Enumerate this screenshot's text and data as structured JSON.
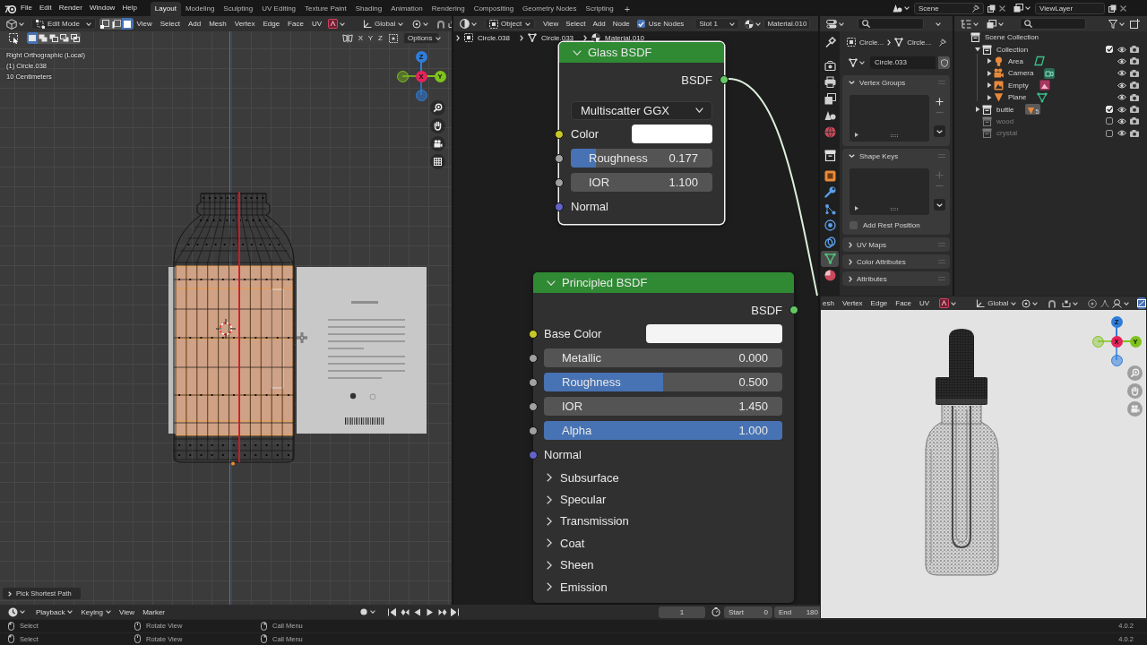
{
  "top_bar": {
    "menus": [
      "File",
      "Edit",
      "Render",
      "Window",
      "Help"
    ],
    "workspaces": [
      {
        "label": "Layout",
        "selected": true
      },
      {
        "label": "Modeling",
        "selected": false
      },
      {
        "label": "Sculpting",
        "selected": false
      },
      {
        "label": "UV Editing",
        "selected": false
      },
      {
        "label": "Texture Paint",
        "selected": false
      },
      {
        "label": "Shading",
        "selected": false
      },
      {
        "label": "Animation",
        "selected": false
      },
      {
        "label": "Rendering",
        "selected": false
      },
      {
        "label": "Compositing",
        "selected": false
      },
      {
        "label": "Geometry Nodes",
        "selected": false
      },
      {
        "label": "Scripting",
        "selected": false
      }
    ],
    "add_workspace": "+",
    "scene": "Scene",
    "view_layer": "ViewLayer"
  },
  "viewport": {
    "mode": "Edit Mode",
    "select_modes": [
      {
        "kind": "vertex",
        "selected": false
      },
      {
        "kind": "edge",
        "selected": false
      },
      {
        "kind": "face",
        "selected": true
      }
    ],
    "menus": [
      "View",
      "Select",
      "Add",
      "Mesh",
      "Vertex",
      "Edge",
      "Face",
      "UV"
    ],
    "orientation": "Global",
    "selection_ops": [
      {
        "kind": "set",
        "selected": true
      },
      {
        "kind": "extend",
        "selected": false
      },
      {
        "kind": "subtract",
        "selected": false
      },
      {
        "kind": "invert",
        "selected": false
      },
      {
        "kind": "intersect",
        "selected": false
      }
    ],
    "mirror_axes": [
      {
        "label": "X",
        "selected": false
      },
      {
        "label": "Y",
        "selected": false
      },
      {
        "label": "Z",
        "selected": false
      }
    ],
    "options": "Options",
    "info": [
      "Right Orthographic (Local)",
      "(1) Circle.038",
      "10 Centimeters"
    ],
    "gizmo": [
      {
        "label": "Z",
        "color": "#2f7ddb"
      },
      {
        "label": "X",
        "color": "#e3245a"
      },
      {
        "label": "Y",
        "color": "#7fc31b"
      }
    ],
    "last_operator": "Pick Shortest Path"
  },
  "node_editor": {
    "mode": "Object",
    "menus": [
      "View",
      "Select",
      "Add",
      "Node"
    ],
    "use_nodes": {
      "label": "Use Nodes",
      "checked": true
    },
    "slot": "Slot 1",
    "material": "Material.010",
    "breadcrumbs": [
      {
        "kind": "object",
        "label": "Circle.038"
      },
      {
        "kind": "mesh",
        "label": "Circle.033"
      },
      {
        "kind": "material",
        "label": "Material.010"
      }
    ],
    "nodes": [
      {
        "title": "Glass BSDF",
        "selected": true,
        "output": "BSDF",
        "distribution": "Multiscatter GGX",
        "inputs": [
          {
            "kind": "color",
            "label": "Color",
            "color": "#ffffff"
          },
          {
            "kind": "slider",
            "label": "Roughness",
            "value": "0.177",
            "level": 0.177
          },
          {
            "kind": "number",
            "label": "IOR",
            "value": "1.100"
          },
          {
            "kind": "vector",
            "label": "Normal"
          }
        ]
      },
      {
        "title": "Principled BSDF",
        "selected": false,
        "output": "BSDF",
        "inputs": [
          {
            "kind": "color",
            "label": "Base Color",
            "color": "#f4f4f4"
          },
          {
            "kind": "slider",
            "label": "Metallic",
            "value": "0.000",
            "level": 0
          },
          {
            "kind": "slider",
            "label": "Roughness",
            "value": "0.500",
            "level": 0.5
          },
          {
            "kind": "number",
            "label": "IOR",
            "value": "1.450"
          },
          {
            "kind": "slider",
            "label": "Alpha",
            "value": "1.000",
            "level": 1
          },
          {
            "kind": "vector",
            "label": "Normal"
          }
        ],
        "panels": [
          {
            "label": "Subsurface",
            "expanded": false
          },
          {
            "label": "Specular",
            "expanded": false
          },
          {
            "label": "Transmission",
            "expanded": false
          },
          {
            "label": "Coat",
            "expanded": false
          },
          {
            "label": "Sheen",
            "expanded": false
          },
          {
            "label": "Emission",
            "expanded": false
          }
        ]
      }
    ]
  },
  "properties": {
    "tabs": [
      {
        "kind": "tool",
        "selected": false
      },
      {
        "kind": "render",
        "selected": false
      },
      {
        "kind": "output",
        "selected": false
      },
      {
        "kind": "view_layer",
        "selected": false
      },
      {
        "kind": "scene",
        "selected": false
      },
      {
        "kind": "world",
        "selected": false
      },
      {
        "kind": "collection",
        "selected": false
      },
      {
        "kind": "object",
        "selected": false
      },
      {
        "kind": "modifiers",
        "selected": false
      },
      {
        "kind": "particles",
        "selected": false
      },
      {
        "kind": "physics",
        "selected": false
      },
      {
        "kind": "constraints",
        "selected": false
      },
      {
        "kind": "data",
        "selected": true
      },
      {
        "kind": "material",
        "selected": false
      }
    ],
    "breadcrumbs": [
      {
        "kind": "object",
        "label": "Circle..."
      },
      {
        "kind": "mesh",
        "label": "Circle..."
      }
    ],
    "mesh_name": "Circle.033",
    "panels": [
      {
        "label": "Vertex Groups",
        "expanded": true,
        "buttons": [
          {
            "kind": "add",
            "disabled": false
          },
          {
            "kind": "remove",
            "disabled": true
          }
        ]
      },
      {
        "label": "Shape Keys",
        "expanded": true,
        "buttons": [
          {
            "kind": "add",
            "disabled": true
          },
          {
            "kind": "remove",
            "disabled": true
          }
        ],
        "options": [
          {
            "label": "Add Rest Position",
            "checked": false
          }
        ]
      },
      {
        "label": "UV Maps",
        "expanded": false
      },
      {
        "label": "Color Attributes",
        "expanded": false
      },
      {
        "label": "Attributes",
        "expanded": false
      }
    ]
  },
  "outliner": {
    "tree": [
      {
        "kind": "scene_collection",
        "label": "Scene Collection",
        "children": [
          {
            "kind": "collection",
            "label": "Collection",
            "expanded": true,
            "checked": true,
            "children": [
              {
                "kind": "light",
                "label": "Area",
                "expanded": false,
                "data": {
                  "kind": "area_light"
                }
              },
              {
                "kind": "camera",
                "label": "Camera",
                "expanded": false,
                "data": {
                  "kind": "camera"
                }
              },
              {
                "kind": "empty",
                "label": "Empty",
                "expanded": false,
                "data": {
                  "kind": "image"
                }
              },
              {
                "kind": "mesh",
                "label": "Plane",
                "expanded": false,
                "data": {
                  "kind": "mesh"
                }
              }
            ]
          },
          {
            "kind": "collection",
            "label": "buttle",
            "expanded": false,
            "checked": true,
            "badge": "5"
          },
          {
            "kind": "collection",
            "label": "wood",
            "checked": false
          },
          {
            "kind": "collection",
            "label": "crystal",
            "checked": false
          }
        ]
      }
    ]
  },
  "render_preview": {
    "menus": [
      "esh",
      "Vertex",
      "Edge",
      "Face",
      "UV"
    ],
    "orientation": "Global",
    "gizmo": [
      {
        "label": "Z",
        "color": "#2f7ddb"
      },
      {
        "label": "X",
        "color": "#e3245a"
      },
      {
        "label": "Y",
        "color": "#7fc31b"
      }
    ]
  },
  "timeline": {
    "menus": [
      {
        "kind": "dropdown",
        "label": "Playback"
      },
      {
        "kind": "dropdown",
        "label": "Keying"
      },
      {
        "kind": "menu",
        "label": "View"
      },
      {
        "kind": "menu",
        "label": "Marker"
      }
    ],
    "current_frame": "1",
    "start": {
      "label": "Start",
      "value": "0"
    },
    "end": {
      "label": "End",
      "value": "180"
    }
  },
  "status_bar": [
    {
      "hints": [
        "Select",
        "Rotate View",
        "Call Menu"
      ],
      "version": "4.0.2"
    },
    {
      "hints": [
        "Select",
        "Rotate View",
        "Call Menu"
      ],
      "version": "4.0.2"
    }
  ]
}
